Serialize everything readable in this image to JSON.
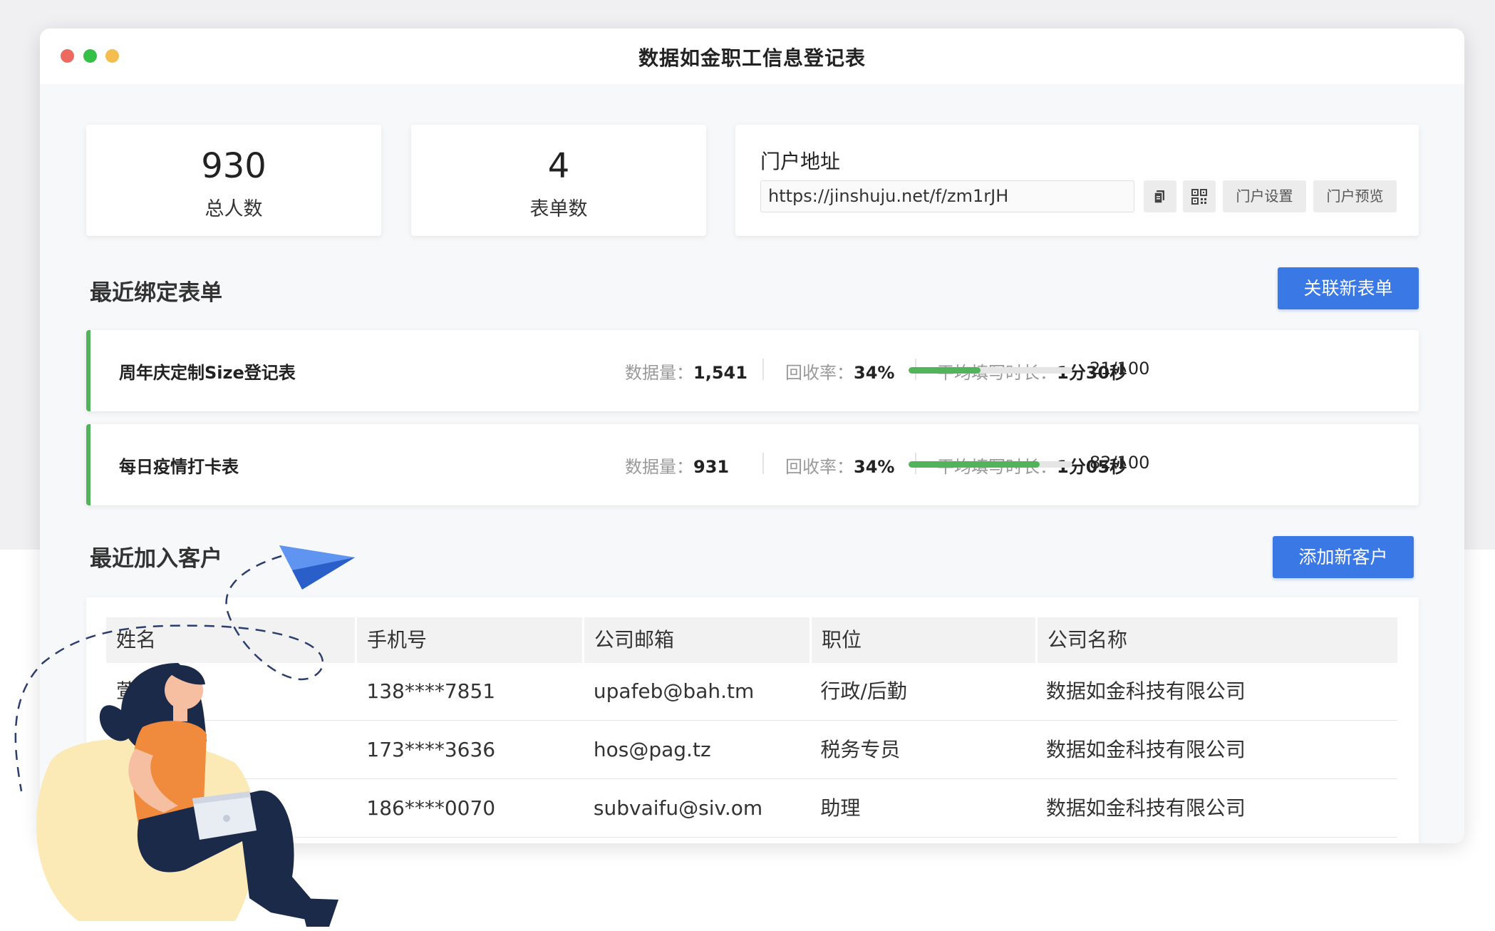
{
  "window": {
    "title": "数据如金职工信息登记表"
  },
  "stats": [
    {
      "value": "930",
      "label": "总人数"
    },
    {
      "value": "4",
      "label": "表单数"
    }
  ],
  "portal": {
    "title": "门户地址",
    "url": "https://jinshuju.net/f/zm1rJH",
    "copy_icon": "copy-icon",
    "qr_icon": "qrcode-icon",
    "settings_label": "门户设置",
    "preview_label": "门户预览"
  },
  "recent_forms": {
    "title": "最近绑定表单",
    "button_label": "关联新表单",
    "items": [
      {
        "name": "周年庆定制Size登记表",
        "data_label": "数据量：",
        "data_value": "1,541",
        "rate_label": "回收率：",
        "rate_value": "34%",
        "time_label": "平均填写时长：",
        "time_value": "1分30秒",
        "progress": 0.44,
        "progress_text": "21/100"
      },
      {
        "name": "每日疫情打卡表",
        "data_label": "数据量：",
        "data_value": "931",
        "rate_label": "回收率：",
        "rate_value": "34%",
        "time_label": "平均填写时长：",
        "time_value": "1分05秒",
        "progress": 0.8,
        "progress_text": "82/100"
      }
    ]
  },
  "recent_customers": {
    "title": "最近加入客户",
    "button_label": "添加新客户",
    "columns": [
      "姓名",
      "手机号",
      "公司邮箱",
      "职位",
      "公司名称"
    ],
    "rows": [
      {
        "name": "萱明",
        "phone": "138****7851",
        "email": "upafeb@bah.tm",
        "position": "行政/后勤",
        "company": "数据如金科技有限公司"
      },
      {
        "name": "",
        "phone": "173****3636",
        "email": "hos@pag.tz",
        "position": "税务专员",
        "company": "数据如金科技有限公司"
      },
      {
        "name": "",
        "phone": "186****0070",
        "email": "subvaifu@siv.om",
        "position": "助理",
        "company": "数据如金科技有限公司"
      }
    ]
  },
  "colors": {
    "accent": "#3a78e6",
    "progress": "#52b45a",
    "window_dots": [
      "#ec6a5f",
      "#35bf49",
      "#f4bd4f"
    ]
  }
}
